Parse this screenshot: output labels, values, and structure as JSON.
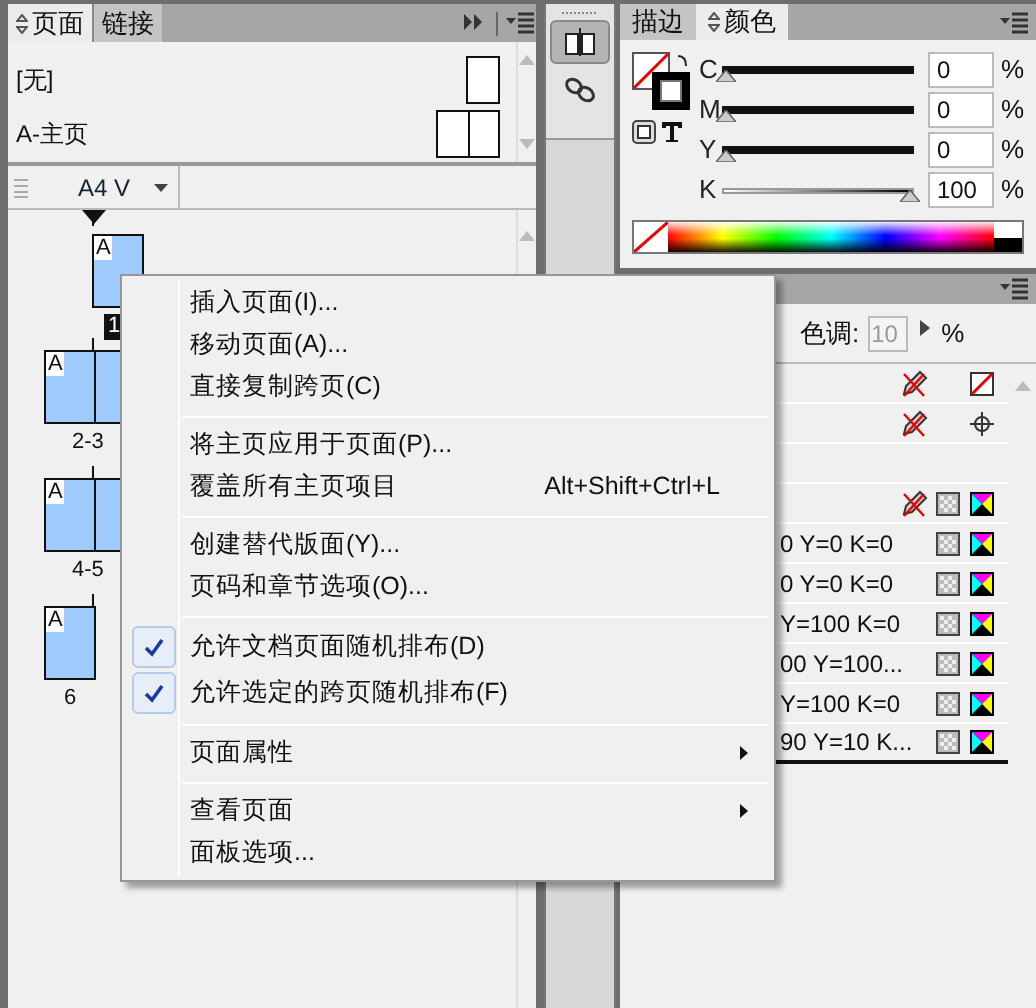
{
  "pages_panel": {
    "tabs": [
      {
        "label": "页面",
        "selected": true
      },
      {
        "label": "链接",
        "selected": false
      }
    ],
    "masters": [
      {
        "name": "[无]",
        "kind": "single"
      },
      {
        "name": "A-主页",
        "kind": "spread"
      }
    ],
    "page_size": "A4 V",
    "pages": [
      {
        "label": "1",
        "kind": "right",
        "master": "A",
        "selected": true
      },
      {
        "label": "2-3",
        "kind": "spread",
        "master": "A",
        "selected": false
      },
      {
        "label": "4-5",
        "kind": "spread",
        "master": "A",
        "selected": false
      },
      {
        "label": "6",
        "kind": "left",
        "master": "A",
        "selected": false
      }
    ]
  },
  "tool_strip": [
    {
      "kind": "pages",
      "selected": true
    },
    {
      "kind": "links",
      "selected": false
    }
  ],
  "color_panel": {
    "tabs": [
      {
        "label": "描边",
        "selected": false
      },
      {
        "label": "颜色",
        "selected": true
      }
    ],
    "channels": [
      {
        "name": "C",
        "level": 0,
        "value": "0",
        "unit": "%"
      },
      {
        "name": "M",
        "level": 0,
        "value": "0",
        "unit": "%"
      },
      {
        "name": "Y",
        "level": 0,
        "value": "0",
        "unit": "%"
      },
      {
        "name": "K",
        "level": 1,
        "value": "100",
        "unit": "%"
      }
    ]
  },
  "swatches_panel": {
    "tint_label": "色调:",
    "tint_value": "10",
    "tint_unit": "%",
    "rows": [
      {
        "kind": "none",
        "locked": true
      },
      {
        "kind": "registration",
        "locked": true
      },
      {
        "kind": "paper",
        "locked": false
      },
      {
        "kind": "process",
        "locked": true
      },
      {
        "name": "0 Y=0 K=0",
        "kind": "process",
        "locked": false
      },
      {
        "name": "0 Y=0 K=0",
        "kind": "process",
        "locked": false
      },
      {
        "name": "Y=100 K=0",
        "kind": "process",
        "locked": false
      },
      {
        "name": "00 Y=100...",
        "kind": "process",
        "locked": false
      },
      {
        "name": "Y=100 K=0",
        "kind": "process",
        "locked": false
      },
      {
        "name": "90 Y=10 K...",
        "kind": "process",
        "locked": false
      }
    ]
  },
  "context_menu": {
    "groups": [
      [
        {
          "label": "插入页面(I)...",
          "checked": false,
          "submenu": false
        },
        {
          "label": "移动页面(A)...",
          "checked": false,
          "submenu": false
        },
        {
          "label": "直接复制跨页(C)",
          "checked": false,
          "submenu": false
        }
      ],
      [
        {
          "label": "将主页应用于页面(P)...",
          "checked": false,
          "submenu": false
        },
        {
          "label": "覆盖所有主页项目",
          "shortcut": "Alt+Shift+Ctrl+L",
          "checked": false,
          "submenu": false
        }
      ],
      [
        {
          "label": "创建替代版面(Y)...",
          "checked": false,
          "submenu": false
        },
        {
          "label": "页码和章节选项(O)...",
          "checked": false,
          "submenu": false
        }
      ],
      [
        {
          "label": "允许文档页面随机排布(D)",
          "checked": true,
          "submenu": false
        },
        {
          "label": "允许选定的跨页随机排布(F)",
          "checked": true,
          "submenu": false
        }
      ],
      [
        {
          "label": "页面属性",
          "checked": false,
          "submenu": true
        }
      ],
      [
        {
          "label": "查看页面",
          "checked": false,
          "submenu": true
        },
        {
          "label": "面板选项...",
          "checked": false,
          "submenu": false
        }
      ]
    ]
  }
}
